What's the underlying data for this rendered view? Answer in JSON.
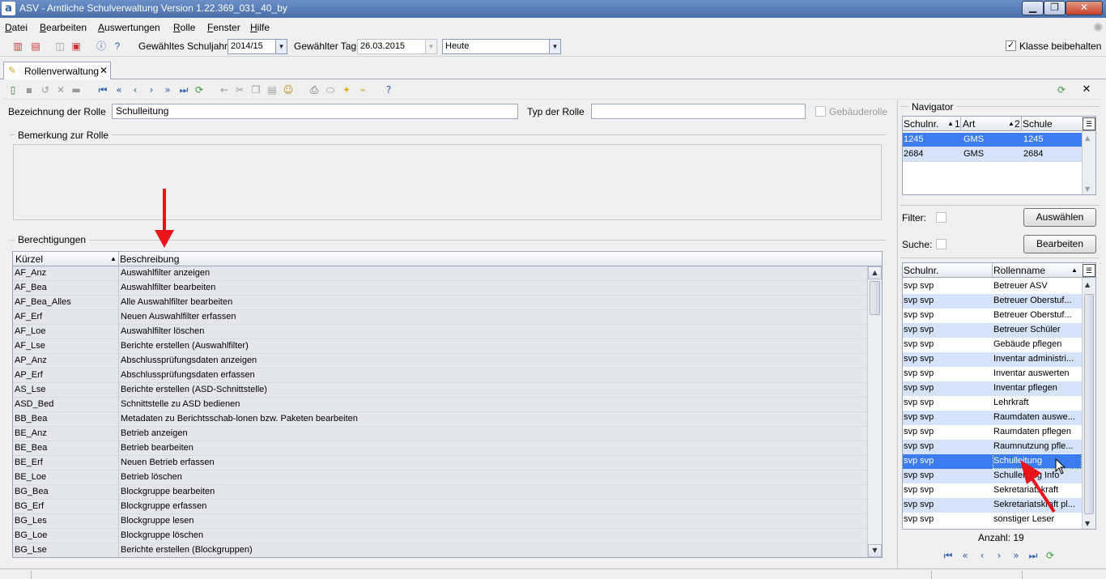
{
  "window": {
    "title": "ASV - Amtliche Schulverwaltung Version 1.22.369_031_40_by",
    "logo": "a"
  },
  "menu": [
    {
      "label": "Datei",
      "acc": "D"
    },
    {
      "label": "Bearbeiten",
      "acc": "B"
    },
    {
      "label": "Auswertungen",
      "acc": "A"
    },
    {
      "label": "Rolle",
      "acc": "R"
    },
    {
      "label": "Fenster",
      "acc": "F"
    },
    {
      "label": "Hilfe",
      "acc": "H"
    }
  ],
  "toolbar": {
    "schuljahr_label": "Gewähltes Schuljahr",
    "schuljahr_value": "2014/15",
    "tag_label": "Gewählter Tag",
    "tag_value": "26.03.2015",
    "heute_value": "Heute",
    "klasse_label": "Klasse beibehalten",
    "klasse_checked": true
  },
  "tab": {
    "label": "Rollenverwaltung",
    "close": "✕"
  },
  "form": {
    "bezeichnung_label": "Bezeichnung der Rolle",
    "bezeichnung_value": "Schulleitung",
    "typ_label": "Typ der Rolle",
    "typ_value": "",
    "gebaeude_label": "Gebäuderolle",
    "bemerkung_label": "Bemerkung zur Rolle",
    "berechtigungen_label": "Berechtigungen"
  },
  "perm_table": {
    "headers": [
      "Kürzel",
      "Beschreibung"
    ],
    "rows": [
      [
        "AF_Anz",
        "Auswahlfilter anzeigen"
      ],
      [
        "AF_Bea",
        "Auswahlfilter bearbeiten"
      ],
      [
        "AF_Bea_Alles",
        "Alle Auswahlfilter bearbeiten"
      ],
      [
        "AF_Erf",
        "Neuen Auswahlfilter erfassen"
      ],
      [
        "AF_Loe",
        "Auswahlfilter löschen"
      ],
      [
        "AF_Lse",
        "Berichte erstellen (Auswahlfilter)"
      ],
      [
        "AP_Anz",
        "Abschlussprüfungsdaten anzeigen"
      ],
      [
        "AP_Erf",
        "Abschlussprüfungsdaten erfassen"
      ],
      [
        "AS_Lse",
        "Berichte erstellen (ASD-Schnittstelle)"
      ],
      [
        "ASD_Bed",
        "Schnittstelle zu ASD bedienen"
      ],
      [
        "BB_Bea",
        "Metadaten zu Berichtsschab-lonen bzw. Paketen bearbeiten"
      ],
      [
        "BE_Anz",
        "Betrieb anzeigen"
      ],
      [
        "BE_Bea",
        "Betrieb bearbeiten"
      ],
      [
        "BE_Erf",
        "Neuen Betrieb erfassen"
      ],
      [
        "BE_Loe",
        "Betrieb löschen"
      ],
      [
        "BG_Bea",
        "Blockgruppe bearbeiten"
      ],
      [
        "BG_Erf",
        "Blockgruppe erfassen"
      ],
      [
        "BG_Les",
        "Blockgruppe lesen"
      ],
      [
        "BG_Loe",
        "Blockgruppe löschen"
      ],
      [
        "BG_Lse",
        "Berichte erstellen (Blockgruppen)"
      ]
    ]
  },
  "navigator": {
    "title": "Navigator",
    "headers": [
      "Schulnr.",
      "Art",
      "Schule"
    ],
    "sort_marks": [
      "1",
      "2"
    ],
    "rows": [
      [
        "1245",
        "GMS",
        "1245"
      ],
      [
        "2684",
        "GMS",
        "2684"
      ]
    ],
    "filter_label": "Filter:",
    "suche_label": "Suche:",
    "auswaehlen_label": "Auswählen",
    "bearbeiten_label": "Bearbeiten"
  },
  "roles_table": {
    "headers": [
      "Schulnr.",
      "Rollenname"
    ],
    "selected_index": 12,
    "rows": [
      [
        "svp svp",
        "Betreuer ASV"
      ],
      [
        "svp svp",
        "Betreuer Oberstuf..."
      ],
      [
        "svp svp",
        "Betreuer Oberstuf..."
      ],
      [
        "svp svp",
        "Betreuer Schüler"
      ],
      [
        "svp svp",
        "Gebäude pflegen"
      ],
      [
        "svp svp",
        "Inventar administri..."
      ],
      [
        "svp svp",
        "Inventar auswerten"
      ],
      [
        "svp svp",
        "Inventar pflegen"
      ],
      [
        "svp svp",
        "Lehrkraft"
      ],
      [
        "svp svp",
        "Raumdaten auswe..."
      ],
      [
        "svp svp",
        "Raumdaten pflegen"
      ],
      [
        "svp svp",
        "Raumnutzung pfle..."
      ],
      [
        "svp svp",
        "Schulleitung"
      ],
      [
        "svp svp",
        "Schulleitung Info"
      ],
      [
        "svp svp",
        "Sekretariatskraft"
      ],
      [
        "svp svp",
        "Sekretariatskraft pl..."
      ],
      [
        "svp svp",
        "sonstiger Leser"
      ]
    ],
    "count_label": "Anzahl: 19"
  },
  "colors": {
    "selected_row": "#3b7cf0",
    "alt_row": "#d6e2f7",
    "arrow": "#e8141a"
  }
}
